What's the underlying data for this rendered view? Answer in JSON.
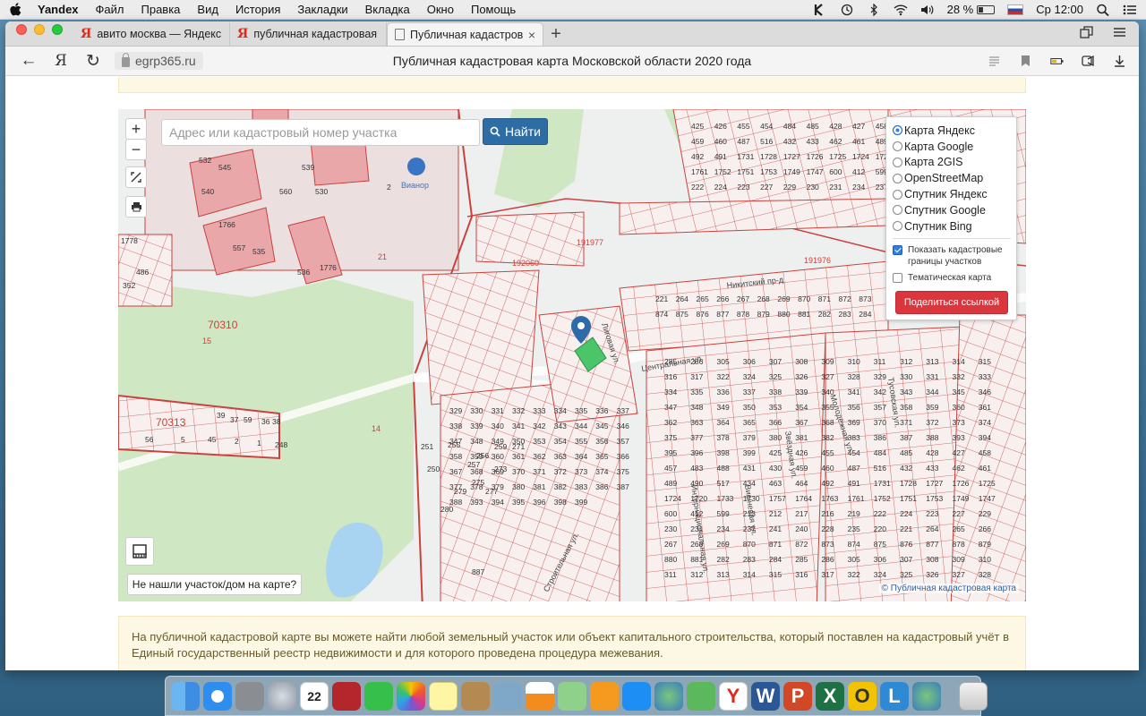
{
  "menubar": {
    "app_name": "Yandex",
    "items": [
      "Файл",
      "Правка",
      "Вид",
      "История",
      "Закладки",
      "Вкладка",
      "Окно",
      "Помощь"
    ],
    "battery": "28 %",
    "clock": "Ср 12:00"
  },
  "tabs": [
    {
      "label": "авито москва — Яндекс: нашл"
    },
    {
      "label": "публичная кадастровая карта"
    },
    {
      "label": "Публичная кадастровая карт"
    }
  ],
  "toolbar": {
    "url": "egrp365.ru",
    "page_heading": "Публичная кадастровая карта Московской области 2020 года"
  },
  "map": {
    "search_placeholder": "Адрес или кадастровый номер участка",
    "find_label": "Найти",
    "zoom_in": "+",
    "zoom_out": "−",
    "layers": [
      "Карта Яндекс",
      "Карта Google",
      "Карта 2GIS",
      "OpenStreetMap",
      "Спутник Яндекс",
      "Спутник Google",
      "Спутник Bing"
    ],
    "selected_layer": "Карта Яндекс",
    "show_boundaries_label": "Показать кадастровые границы участков",
    "show_boundaries_checked": true,
    "thematic_label": "Тематическая карта",
    "thematic_checked": false,
    "share_label": "Поделиться ссылкой",
    "not_found_label": "Не нашли участок/дом на карте?",
    "attribution": "© Публичная кадастровая карта",
    "poi_label": "Вианор",
    "street_labels": [
      "Никитский пр-д",
      "Центральная ул.",
      "Лиговая ул.",
      "Интернациональная ул.",
      "Строительная ул.",
      "Вишневая ул.",
      "Звёздная ул.",
      "Молодёжная ул.",
      "Тусовская ул."
    ],
    "area_labels": [
      "70310",
      "70313",
      "191977",
      "192060",
      "191976",
      "15",
      "14",
      "21"
    ],
    "parcel_numbers": [
      "425",
      "426",
      "455",
      "454",
      "484",
      "485",
      "428",
      "427",
      "458",
      "457",
      "483",
      "488",
      "431",
      "430",
      "459",
      "460",
      "487",
      "516",
      "432",
      "433",
      "462",
      "461",
      "489",
      "490",
      "517",
      "434",
      "463",
      "464",
      "492",
      "491",
      "1731",
      "1728",
      "1727",
      "1726",
      "1725",
      "1724",
      "1720",
      "1733",
      "1730",
      "1757",
      "1764",
      "1763",
      "1761",
      "1752",
      "1751",
      "1753",
      "1749",
      "1747",
      "600",
      "412",
      "599",
      "213",
      "212",
      "217",
      "216",
      "219",
      "222",
      "224",
      "223",
      "227",
      "229",
      "230",
      "231",
      "234",
      "237",
      "241",
      "240",
      "228",
      "235",
      "220",
      "221",
      "264",
      "265",
      "266",
      "267",
      "268",
      "269",
      "870",
      "871",
      "872",
      "873",
      "874",
      "875",
      "876",
      "877",
      "878",
      "879",
      "880",
      "881",
      "282",
      "283",
      "284",
      "285",
      "286",
      "305",
      "306",
      "307",
      "308",
      "309",
      "310",
      "311",
      "312",
      "313",
      "314",
      "315",
      "316",
      "317",
      "322",
      "324",
      "325",
      "326",
      "327",
      "328",
      "329",
      "330",
      "331",
      "332",
      "333",
      "334",
      "335",
      "336",
      "337",
      "338",
      "339",
      "340",
      "341",
      "342",
      "343",
      "344",
      "345",
      "346",
      "347",
      "348",
      "349",
      "350",
      "353",
      "354",
      "355",
      "356",
      "357",
      "358",
      "359",
      "360",
      "361",
      "362",
      "363",
      "364",
      "365",
      "366",
      "367",
      "368",
      "369",
      "370",
      "371",
      "372",
      "373",
      "374",
      "375",
      "377",
      "378",
      "379",
      "380",
      "381",
      "382",
      "383",
      "386",
      "387",
      "388",
      "393",
      "394",
      "395",
      "396",
      "398",
      "399"
    ],
    "left_parcels": [
      "532",
      "545",
      "539",
      "540",
      "560",
      "530",
      "557",
      "535",
      "536",
      "1766",
      "1776",
      "1778",
      "486",
      "352",
      "2",
      "39",
      "37",
      "59",
      "36",
      "38",
      "56",
      "5",
      "45",
      "2",
      "1",
      "248",
      "251",
      "250",
      "255",
      "257",
      "256",
      "259",
      "271",
      "273",
      "275",
      "277",
      "279",
      "280",
      "887"
    ]
  },
  "info_text": "На публичной кадастровой карте вы можете найти любой земельный участок или объект капитального строительства, который поставлен на кадастровый учёт в Единый государственный реестр недвижимости и для которого проведена процедура межевания.",
  "dock": [
    "Finder",
    "Safari",
    "System Preferences",
    "Launchpad",
    "Calendar",
    "Photo Booth",
    "FaceTime",
    "Photos",
    "Notes",
    "Contacts",
    "Preview",
    "VLC",
    "Maps",
    "Books",
    "App Store",
    "Disk Utility",
    "uTorrent",
    "Yandex",
    "Word",
    "PowerPoint",
    "Excel",
    "Outlook",
    "Lync",
    "Network",
    "Trash"
  ],
  "dock_calendar_day": "22",
  "colors": {
    "parcel_line": "#c9423d",
    "building_fill": "#e9a7aa",
    "green_area": "#cde6bf",
    "water": "#a8d3f1",
    "find_button": "#2e6da4",
    "share_button": "#d9363e"
  }
}
